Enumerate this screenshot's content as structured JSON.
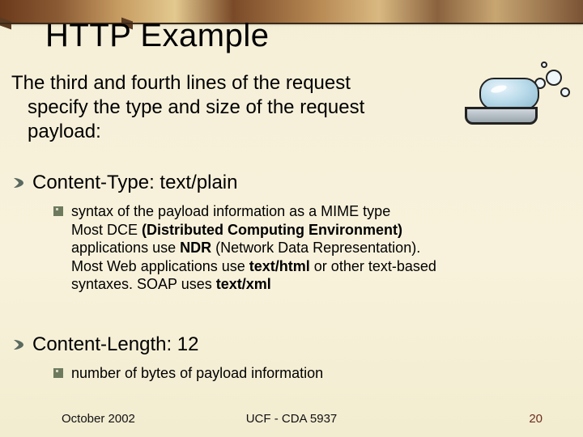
{
  "title": "HTTP Example",
  "intro": {
    "line1": "The third and fourth lines of the request",
    "line2": "specify the type and size of the request",
    "line3": "payload:"
  },
  "section1": {
    "head": "Content-Type: text/plain",
    "sub1": "syntax of the payload information as a MIME type",
    "sub2a": "Most DCE ",
    "sub2b": "(Distributed Computing Environment)",
    "sub3a": "applications use ",
    "sub3b": "NDR",
    "sub3c": " (Network Data Representation).",
    "sub4a": "Most Web applications use ",
    "sub4b": "text/html",
    "sub4c": " or other text-based",
    "sub5a": "syntaxes. SOAP uses ",
    "sub5b": "text/xml"
  },
  "section2": {
    "head": "Content-Length: 12",
    "sub1": "number of bytes of payload information"
  },
  "footer": {
    "date": "October 2002",
    "center": "UCF - CDA 5937",
    "num": "20"
  }
}
